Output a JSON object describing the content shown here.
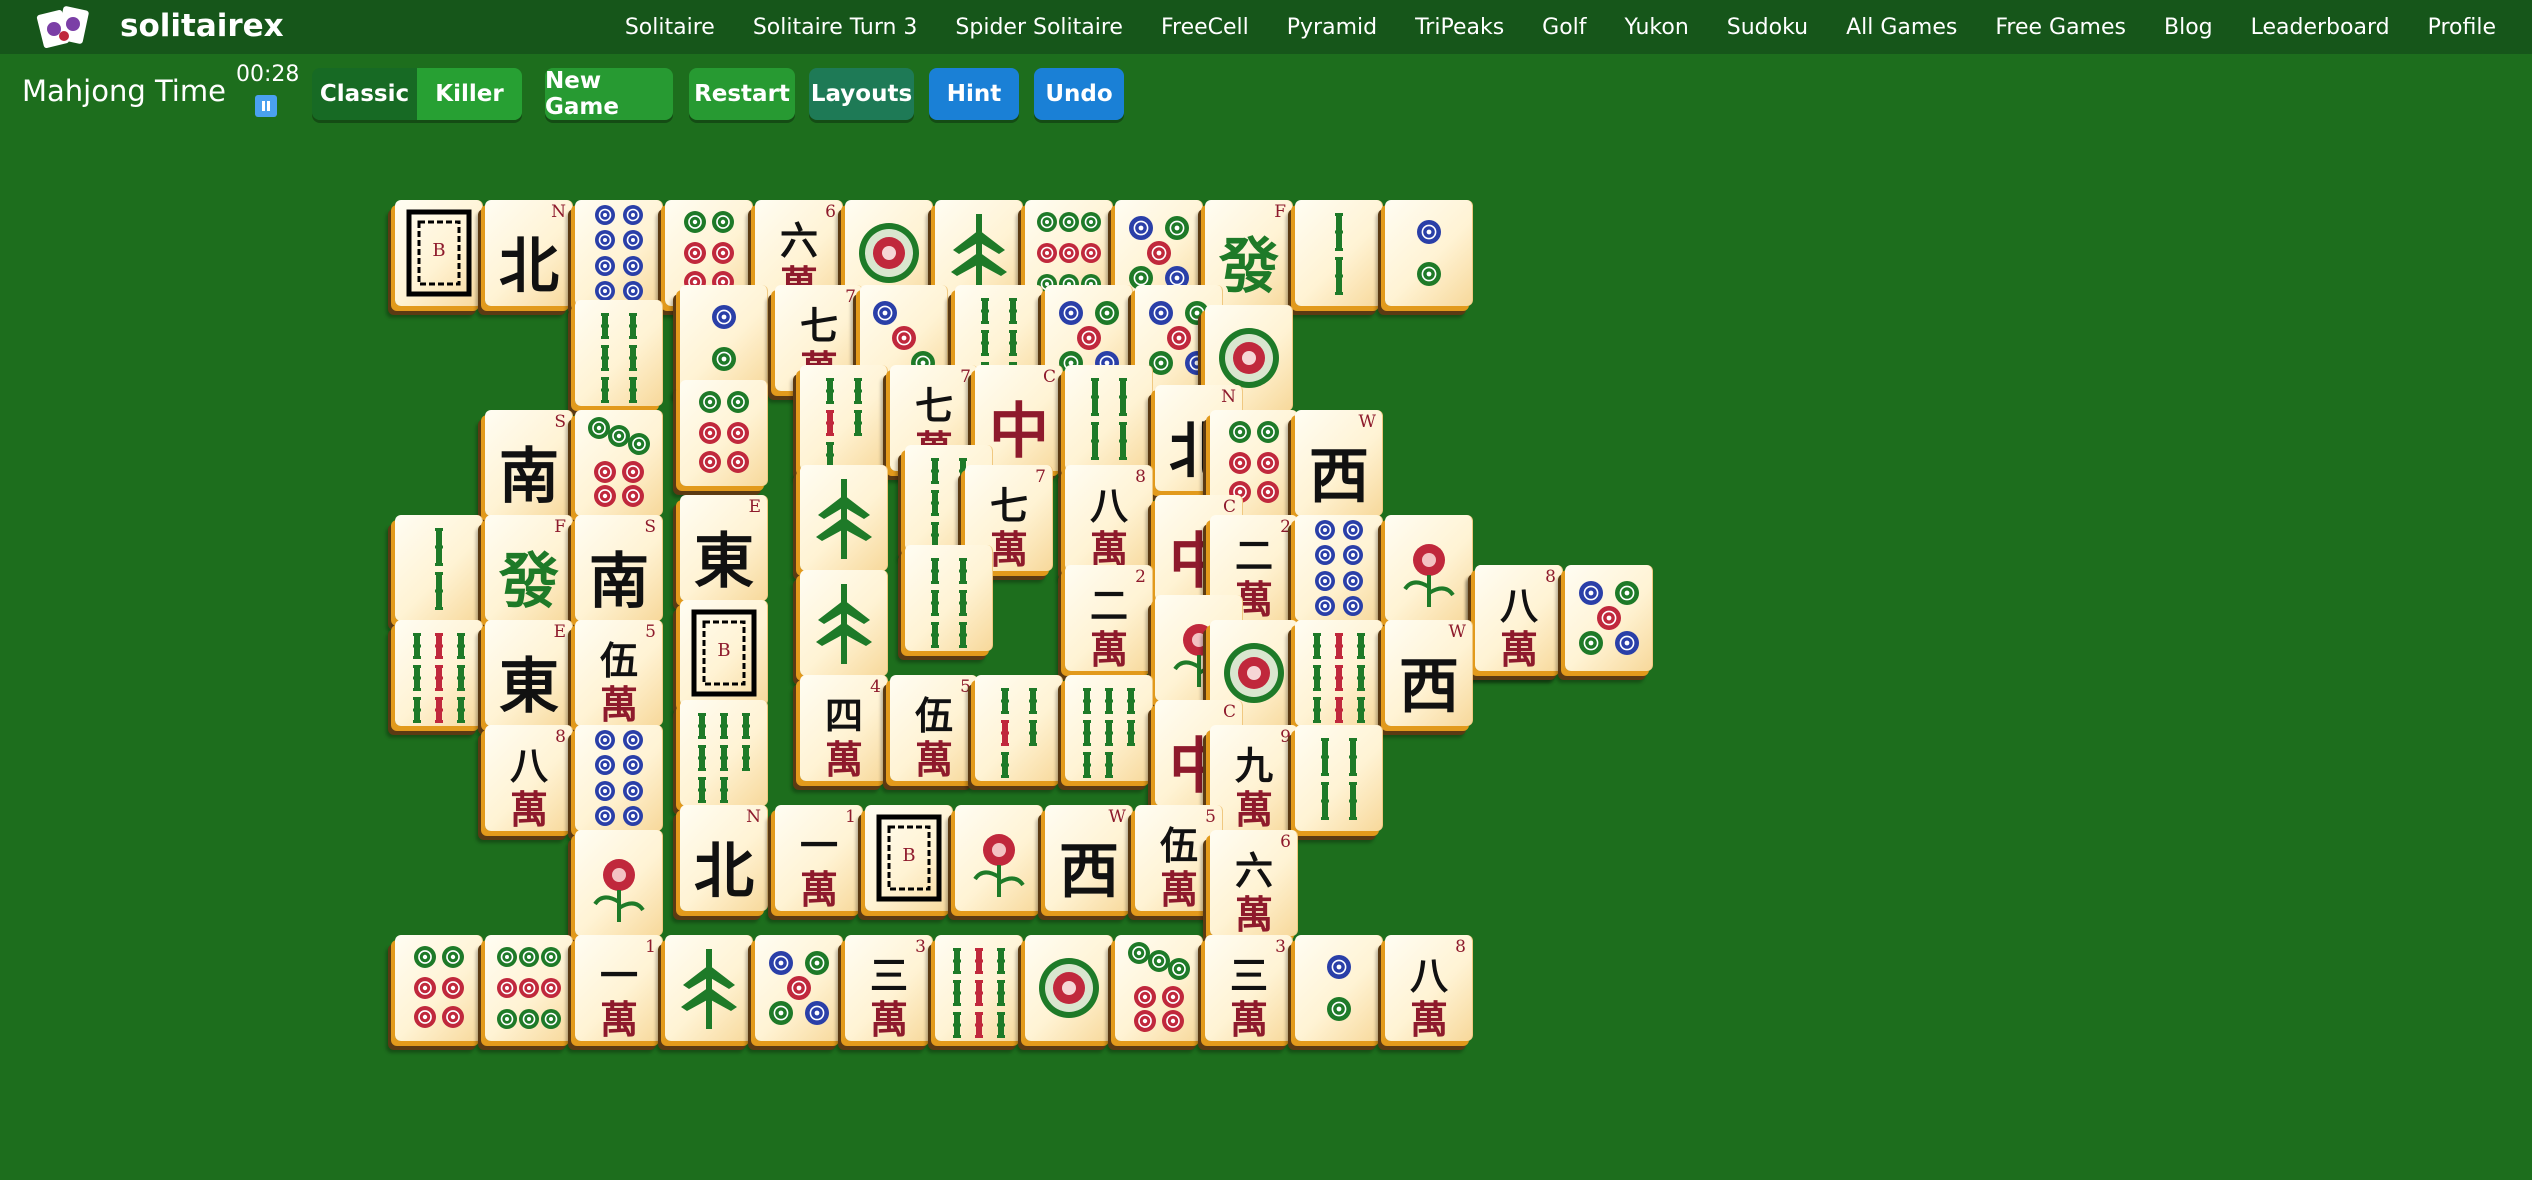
{
  "brand": "solitairex",
  "nav": [
    "Solitaire",
    "Solitaire Turn 3",
    "Spider Solitaire",
    "FreeCell",
    "Pyramid",
    "TriPeaks",
    "Golf",
    "Yukon",
    "Sudoku",
    "All Games",
    "Free Games",
    "Blog",
    "Leaderboard",
    "Profile"
  ],
  "game": {
    "title": "Mahjong Time",
    "timer": "00:28",
    "mode_classic": "Classic",
    "mode_killer": "Killer",
    "new_game": "New Game",
    "restart": "Restart",
    "layouts": "Layouts",
    "hint": "Hint",
    "undo": "Undo"
  },
  "colors": {
    "background": "#1d6e1d",
    "nav_bg": "#16561a",
    "green_button": "#279a32",
    "blue_button": "#1a80d6",
    "teal_button": "#1e7a56",
    "dot_red": "#c0283c",
    "dot_green": "#1e7a28",
    "dot_blue": "#2a3fa8",
    "bamboo": "#1e7a28",
    "character_red": "#8e1a2c"
  },
  "tiles": [
    {
      "t": "bw",
      "l": "B"
    },
    {
      "t": "w",
      "g": "北",
      "i": "N"
    },
    {
      "t": "d",
      "n": 8
    },
    {
      "t": "d",
      "n": 6
    },
    {
      "t": "m",
      "g": "六",
      "i": "6"
    },
    {
      "t": "d",
      "n": 1
    },
    {
      "t": "bird"
    },
    {
      "t": "d",
      "n": 9
    },
    {
      "t": "d",
      "n": 5
    },
    {
      "t": "w",
      "g": "發",
      "i": "F",
      "c": "g"
    },
    {
      "t": "b",
      "n": 2
    },
    {
      "t": "d",
      "n": 2
    },
    {
      "t": "b",
      "n": 6
    },
    {
      "t": "d",
      "n": 2
    },
    {
      "t": "m",
      "g": "七",
      "i": "7"
    },
    {
      "t": "d",
      "n": 3
    },
    {
      "t": "b",
      "n": 6
    },
    {
      "t": "d",
      "n": 5
    },
    {
      "t": "d",
      "n": 5
    },
    {
      "t": "d",
      "n": 1
    },
    {
      "t": "w",
      "g": "南",
      "i": "S"
    },
    {
      "t": "d",
      "n": 7
    },
    {
      "t": "d",
      "n": 6
    },
    {
      "t": "b",
      "n": 5
    },
    {
      "t": "m",
      "g": "七",
      "i": "7"
    },
    {
      "t": "w",
      "g": "中",
      "i": "C",
      "c": "r"
    },
    {
      "t": "b",
      "n": 4
    },
    {
      "t": "w",
      "g": "北",
      "i": "N"
    },
    {
      "t": "d",
      "n": 6
    },
    {
      "t": "w",
      "g": "西",
      "i": "W"
    },
    {
      "t": "b",
      "n": 2
    },
    {
      "t": "w",
      "g": "發",
      "i": "F",
      "c": "g"
    },
    {
      "t": "w",
      "g": "南",
      "i": "S"
    },
    {
      "t": "w",
      "g": "東",
      "i": "E"
    },
    {
      "t": "bird"
    },
    {
      "t": "b",
      "n": 6
    },
    {
      "t": "m",
      "g": "七",
      "i": "7"
    },
    {
      "t": "m",
      "g": "八",
      "i": "8"
    },
    {
      "t": "w",
      "g": "中",
      "i": "C",
      "c": "r"
    },
    {
      "t": "m",
      "g": "二",
      "i": "2"
    },
    {
      "t": "d",
      "n": 8
    },
    {
      "t": "fl"
    },
    {
      "t": "d",
      "n": 6
    },
    {
      "t": "m",
      "g": "八",
      "i": "8"
    },
    {
      "t": "d",
      "n": 5
    },
    {
      "t": "b",
      "n": 9
    },
    {
      "t": "w",
      "g": "東",
      "i": "E"
    },
    {
      "t": "m",
      "g": "伍",
      "i": "5"
    },
    {
      "t": "bw",
      "l": "B"
    },
    {
      "t": "bird"
    },
    {
      "t": "b",
      "n": 6
    },
    {
      "t": "m",
      "g": "二",
      "i": "2"
    },
    {
      "t": "fl2"
    },
    {
      "t": "d",
      "n": 1
    },
    {
      "t": "b",
      "n": 9
    },
    {
      "t": "w",
      "g": "西",
      "i": "W"
    },
    {
      "t": "m",
      "g": "八",
      "i": "8"
    },
    {
      "t": "d",
      "n": 8
    },
    {
      "t": "b",
      "n": 8
    },
    {
      "t": "m",
      "g": "四",
      "i": "4"
    },
    {
      "t": "m",
      "g": "伍",
      "i": "5"
    },
    {
      "t": "b",
      "n": 5
    },
    {
      "t": "b",
      "n": 8
    },
    {
      "t": "w",
      "g": "中",
      "i": "C",
      "c": "r"
    },
    {
      "t": "m",
      "g": "九",
      "i": "9"
    },
    {
      "t": "b",
      "n": 4
    },
    {
      "t": "fl3"
    },
    {
      "t": "w",
      "g": "北",
      "i": "N"
    },
    {
      "t": "m",
      "g": "一",
      "i": "1"
    },
    {
      "t": "bw",
      "l": "B"
    },
    {
      "t": "fl4"
    },
    {
      "t": "w",
      "g": "西",
      "i": "W"
    },
    {
      "t": "m",
      "g": "伍",
      "i": "5"
    },
    {
      "t": "m",
      "g": "六",
      "i": "6"
    },
    {
      "t": "d",
      "n": 6
    },
    {
      "t": "d",
      "n": 9
    },
    {
      "t": "m",
      "g": "一",
      "i": "1"
    },
    {
      "t": "bird"
    },
    {
      "t": "d",
      "n": 5
    },
    {
      "t": "m",
      "g": "三",
      "i": "3"
    },
    {
      "t": "b",
      "n": 9
    },
    {
      "t": "d",
      "n": 1
    },
    {
      "t": "d",
      "n": 7
    },
    {
      "t": "m",
      "g": "三",
      "i": "3"
    },
    {
      "t": "d",
      "n": 2
    },
    {
      "t": "m",
      "g": "八",
      "i": "8"
    }
  ]
}
